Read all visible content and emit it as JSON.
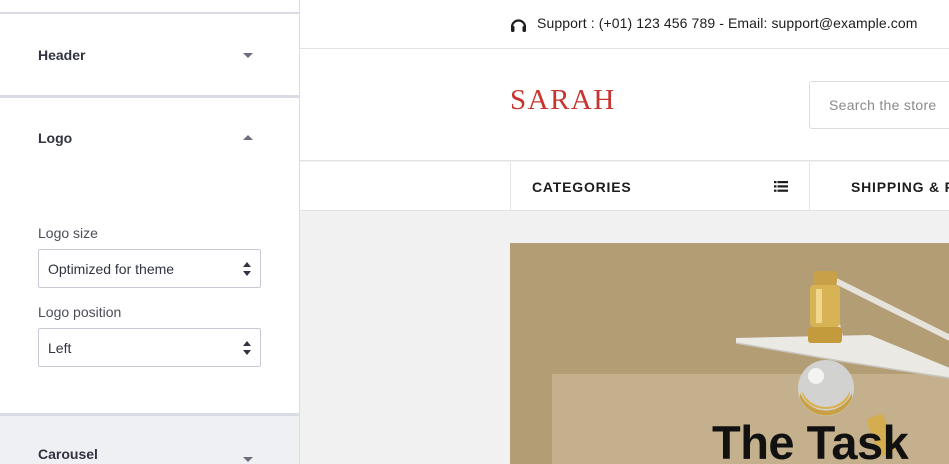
{
  "sidebar": {
    "sections": {
      "header": {
        "title": "Header",
        "state": "collapsed"
      },
      "logo": {
        "title": "Logo",
        "state": "expanded",
        "size_label": "Logo size",
        "size_value": "Optimized for theme",
        "position_label": "Logo position",
        "position_value": "Left"
      },
      "carousel": {
        "title": "Carousel",
        "state": "collapsed"
      }
    }
  },
  "preview": {
    "support_text": "Support : (+01) 123 456 789 - Email: support@example.com",
    "logo_text": "SARAH",
    "search_placeholder": "Search the store",
    "nav": {
      "categories_label": "CATEGORIES",
      "shipping_label": "SHIPPING & R"
    },
    "banner_title": "The Task"
  },
  "icons": {
    "support": "headset-icon",
    "categories": "list-icon",
    "header_toggle": "chevron-down-icon",
    "logo_toggle": "chevron-up-icon",
    "carousel_toggle": "chevron-down-icon"
  },
  "colors": {
    "logo": "#c8342e",
    "divider": "#d9dce4",
    "banner_bg": "#b39d74",
    "preview_bg": "#f1f1f1"
  }
}
